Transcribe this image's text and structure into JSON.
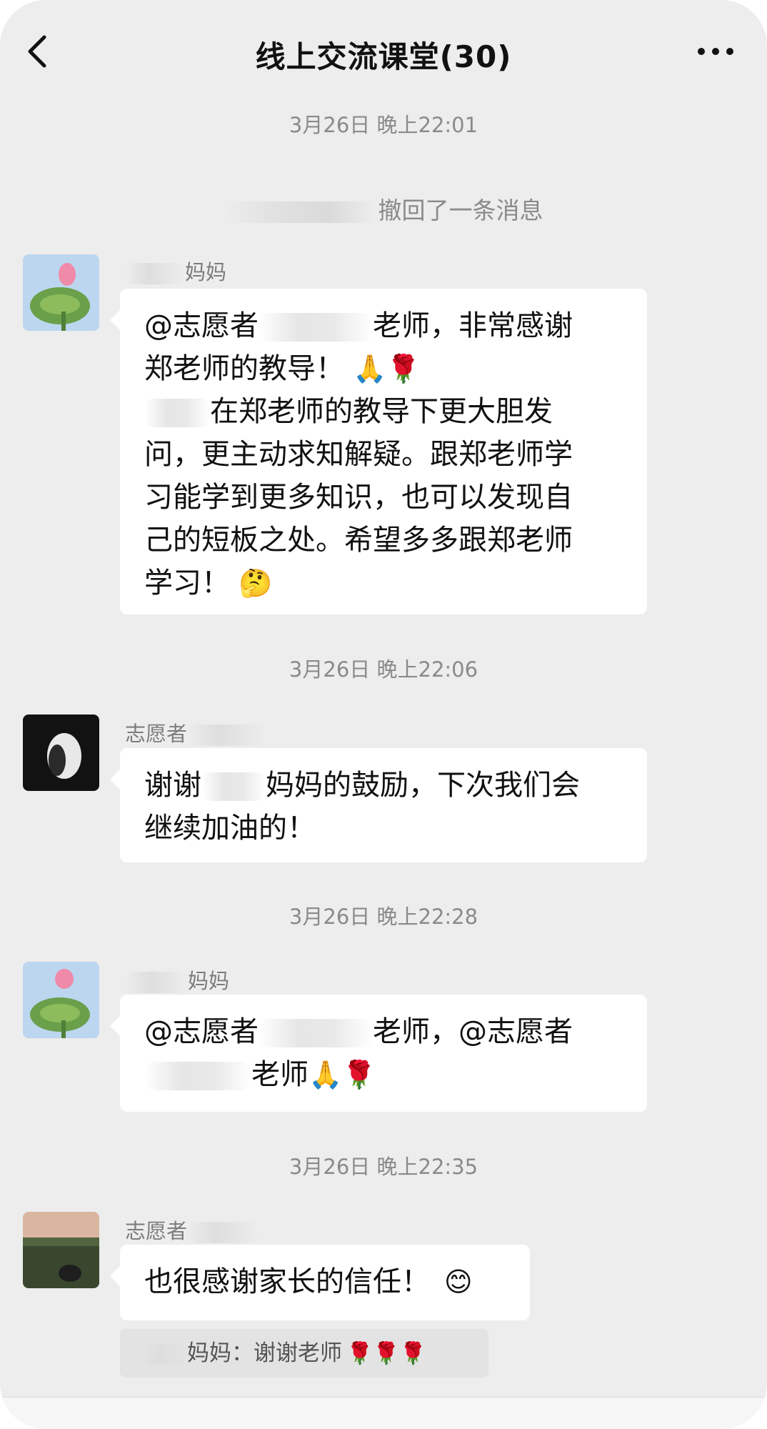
{
  "header": {
    "title": "线上交流课堂(30)",
    "back_icon": "chevron-left-icon",
    "more_icon": "more-dots-icon"
  },
  "messages": {
    "ts1": "3月26日 晚上22:01",
    "system_recall": "撤回了一条消息",
    "m1": {
      "sender": "妈妈",
      "line1_a": "@志愿者",
      "line1_b": "老师，非常感谢",
      "line2": "郑老师的教导！",
      "line3": "在郑老师的教导下更大胆发",
      "line4": "问，更主动求知解疑。跟郑老师学",
      "line5": "习能学到更多知识，也可以发现自",
      "line6": "己的短板之处。希望多多跟郑老师",
      "line7": "学习！",
      "emoji_a": "🙏🌹",
      "emoji_b": "🤔"
    },
    "ts2": "3月26日 晚上22:06",
    "m2": {
      "sender": "志愿者",
      "line1_a": "谢谢",
      "line1_b": "妈妈的鼓励，下次我们会",
      "line2": "继续加油的！"
    },
    "ts3": "3月26日 晚上22:28",
    "m3": {
      "sender": "妈妈",
      "line1_a": "@志愿者",
      "line1_b": "老师，@志愿者",
      "line2": "老师",
      "emoji": "🙏🌹"
    },
    "ts4": "3月26日 晚上22:35",
    "m4": {
      "sender": "志愿者",
      "text": "也很感谢家长的信任！",
      "emoji": "😊"
    },
    "quote": {
      "text": "妈妈：谢谢老师",
      "emoji": "🌹🌹🌹"
    }
  },
  "colors": {
    "background": "#ededed",
    "bubble": "#ffffff",
    "timestamp": "#8a8a8a",
    "quote_bg": "#e3e3e3"
  }
}
